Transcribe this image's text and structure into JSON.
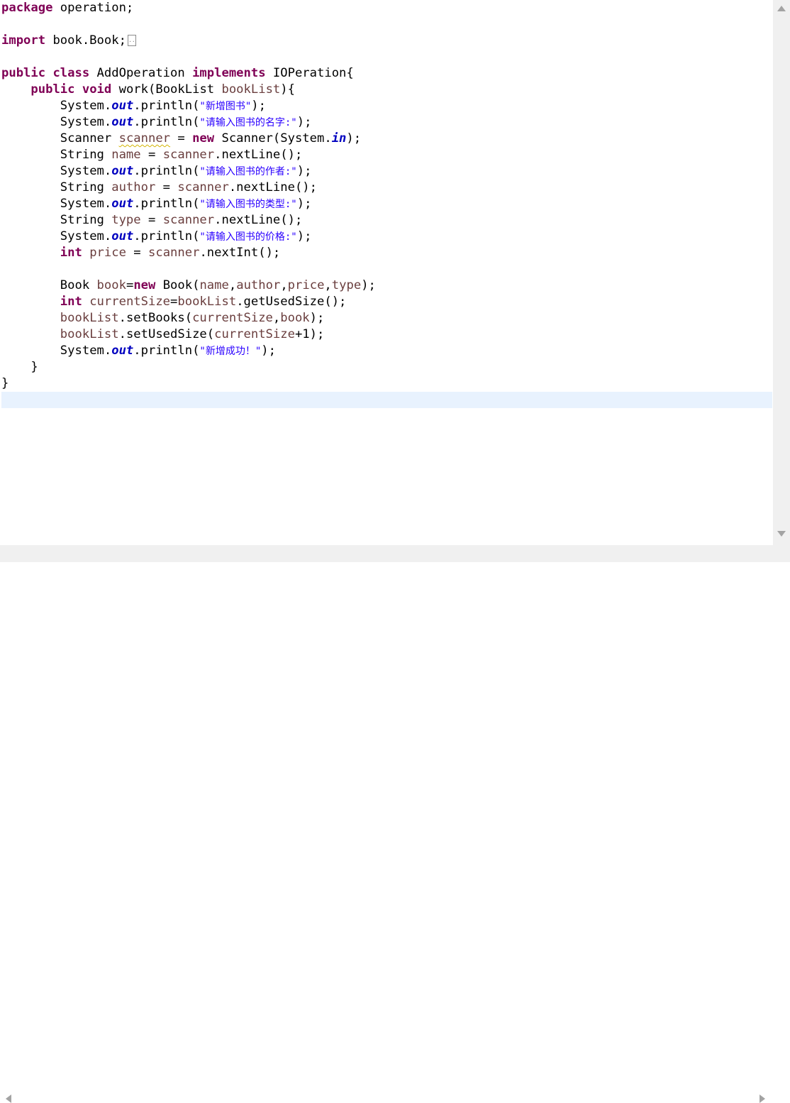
{
  "code": {
    "l1_kw": "package",
    "l1_rest": " operation;",
    "l2_kw": "import",
    "l2_rest": " book.Book;",
    "l2_fold": "..",
    "l3_kw1": "public",
    "l3_kw2": "class",
    "l3_name": " AddOperation ",
    "l3_kw3": "implements",
    "l3_rest": " IOPeration{",
    "l4_kw1": "public",
    "l4_kw2": "void",
    "l4_mid": " work(BookList ",
    "l4_param": "bookList",
    "l4_rest": "){",
    "sys": "System.",
    "out": "out",
    "println_open": ".println(",
    "println_close": ");",
    "s1": "\"新增图书\"",
    "s2": "\"请输入图书的名字:\"",
    "l7_type": "Scanner ",
    "l7_var": "scanner",
    "l7_eq": " = ",
    "new_kw": "new",
    "l7_ctor": " Scanner(System.",
    "l7_in": "in",
    "l7_end": ");",
    "string_type": "String ",
    "eq": " = ",
    "scanner_ref": "scanner",
    "next_line": ".nextLine();",
    "v_name": "name",
    "v_author": "author",
    "v_type": "type",
    "v_price": "price",
    "s3": "\"请输入图书的作者:\"",
    "s4": "\"请输入图书的类型:\"",
    "s5": "\"请输入图书的价格:\"",
    "int_kw": "int",
    "next_int": ".nextInt();",
    "l16_type": "Book ",
    "l16_var": "book",
    "l16_eq": "=",
    "l16_ctor": " Book(",
    "comma": ",",
    "l16_end": ");",
    "l17_var": "currentSize",
    "l17_eq": "=",
    "l17_ref": "bookList",
    "l17_call": ".getUsedSize();",
    "l18_ref": "bookList",
    "l18_call": ".setBooks(",
    "l18_a1": "currentSize",
    "l18_a2": "book",
    "l18_end": ");",
    "l19_ref": "bookList",
    "l19_call": ".setUsedSize(",
    "l19_a1": "currentSize",
    "l19_end": "+1);",
    "s6": "\"新增成功！\"",
    "close_method": "}",
    "close_class": "}"
  }
}
